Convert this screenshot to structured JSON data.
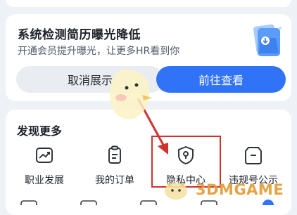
{
  "promo": {
    "title": "系统检测简历曝光降低",
    "subtitle": "开通会员提升曝光，让更多HR看到你",
    "cancel_label": "取消展示",
    "view_label": "前往查看",
    "icon": "resume-folder-icon"
  },
  "discover": {
    "title": "发现更多",
    "items": [
      {
        "label": "职业发展",
        "icon": "career-growth-icon"
      },
      {
        "label": "我的订单",
        "icon": "order-icon"
      },
      {
        "label": "隐私中心",
        "icon": "privacy-shield-icon"
      },
      {
        "label": "违规号公示",
        "icon": "violation-notice-icon"
      }
    ]
  },
  "watermark": {
    "text": "3DMGAME"
  },
  "colors": {
    "primary": "#3173f6",
    "highlight": "#d0312f",
    "background": "#eef1f6"
  }
}
